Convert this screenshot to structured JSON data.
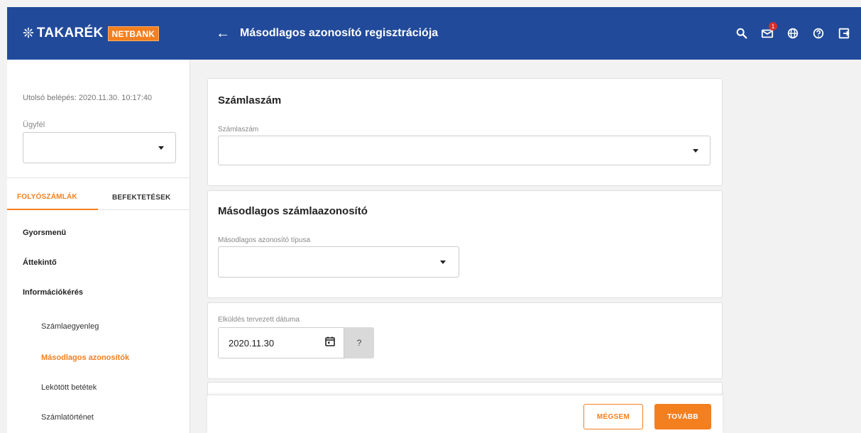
{
  "header": {
    "logo_mark": "❊",
    "logo_text": "TAKARÉK",
    "logo_badge": "NETBANK",
    "back_icon": "arrow-left-icon",
    "title": "Másodlagos azonosító regisztrációja",
    "icons": [
      "search-icon",
      "mail-icon",
      "globe-icon",
      "help-icon",
      "logout-icon"
    ],
    "notification_count": "1"
  },
  "sidebar": {
    "last_login": "Utolsó belépés: 2020.11.30. 10:17:40",
    "client_label": "Ügyfél",
    "client_value": "",
    "tabs": [
      {
        "label": "FOLYÓSZÁMLÁK",
        "active": true
      },
      {
        "label": "BEFEKTETÉSEK",
        "active": false
      }
    ],
    "items": [
      {
        "label": "Gyorsmenü"
      },
      {
        "label": "Áttekintő"
      },
      {
        "label": "Információkérés"
      }
    ],
    "subitems": [
      {
        "label": "Számlaegyenleg",
        "active": false
      },
      {
        "label": "Másodlagos azonosítók",
        "active": true
      },
      {
        "label": "Lekötött betétek",
        "active": false
      },
      {
        "label": "Számlatörténet",
        "active": false
      }
    ]
  },
  "main": {
    "account_card": {
      "title": "Számlaszám",
      "field_label": "Számlaszám",
      "value": ""
    },
    "secondary_card": {
      "title": "Másodlagos számlaazonosító",
      "field_label": "Másodlagos azonosító típusa",
      "value": ""
    },
    "date_card": {
      "field_label": "Elküldés tervezett dátuma",
      "value": "2020.11.30",
      "help_label": "?"
    }
  },
  "footer": {
    "cancel_label": "MÉGSEM",
    "next_label": "TOVÁBB"
  },
  "colors": {
    "header_bg": "#214a9a",
    "accent": "#f47f1f"
  }
}
